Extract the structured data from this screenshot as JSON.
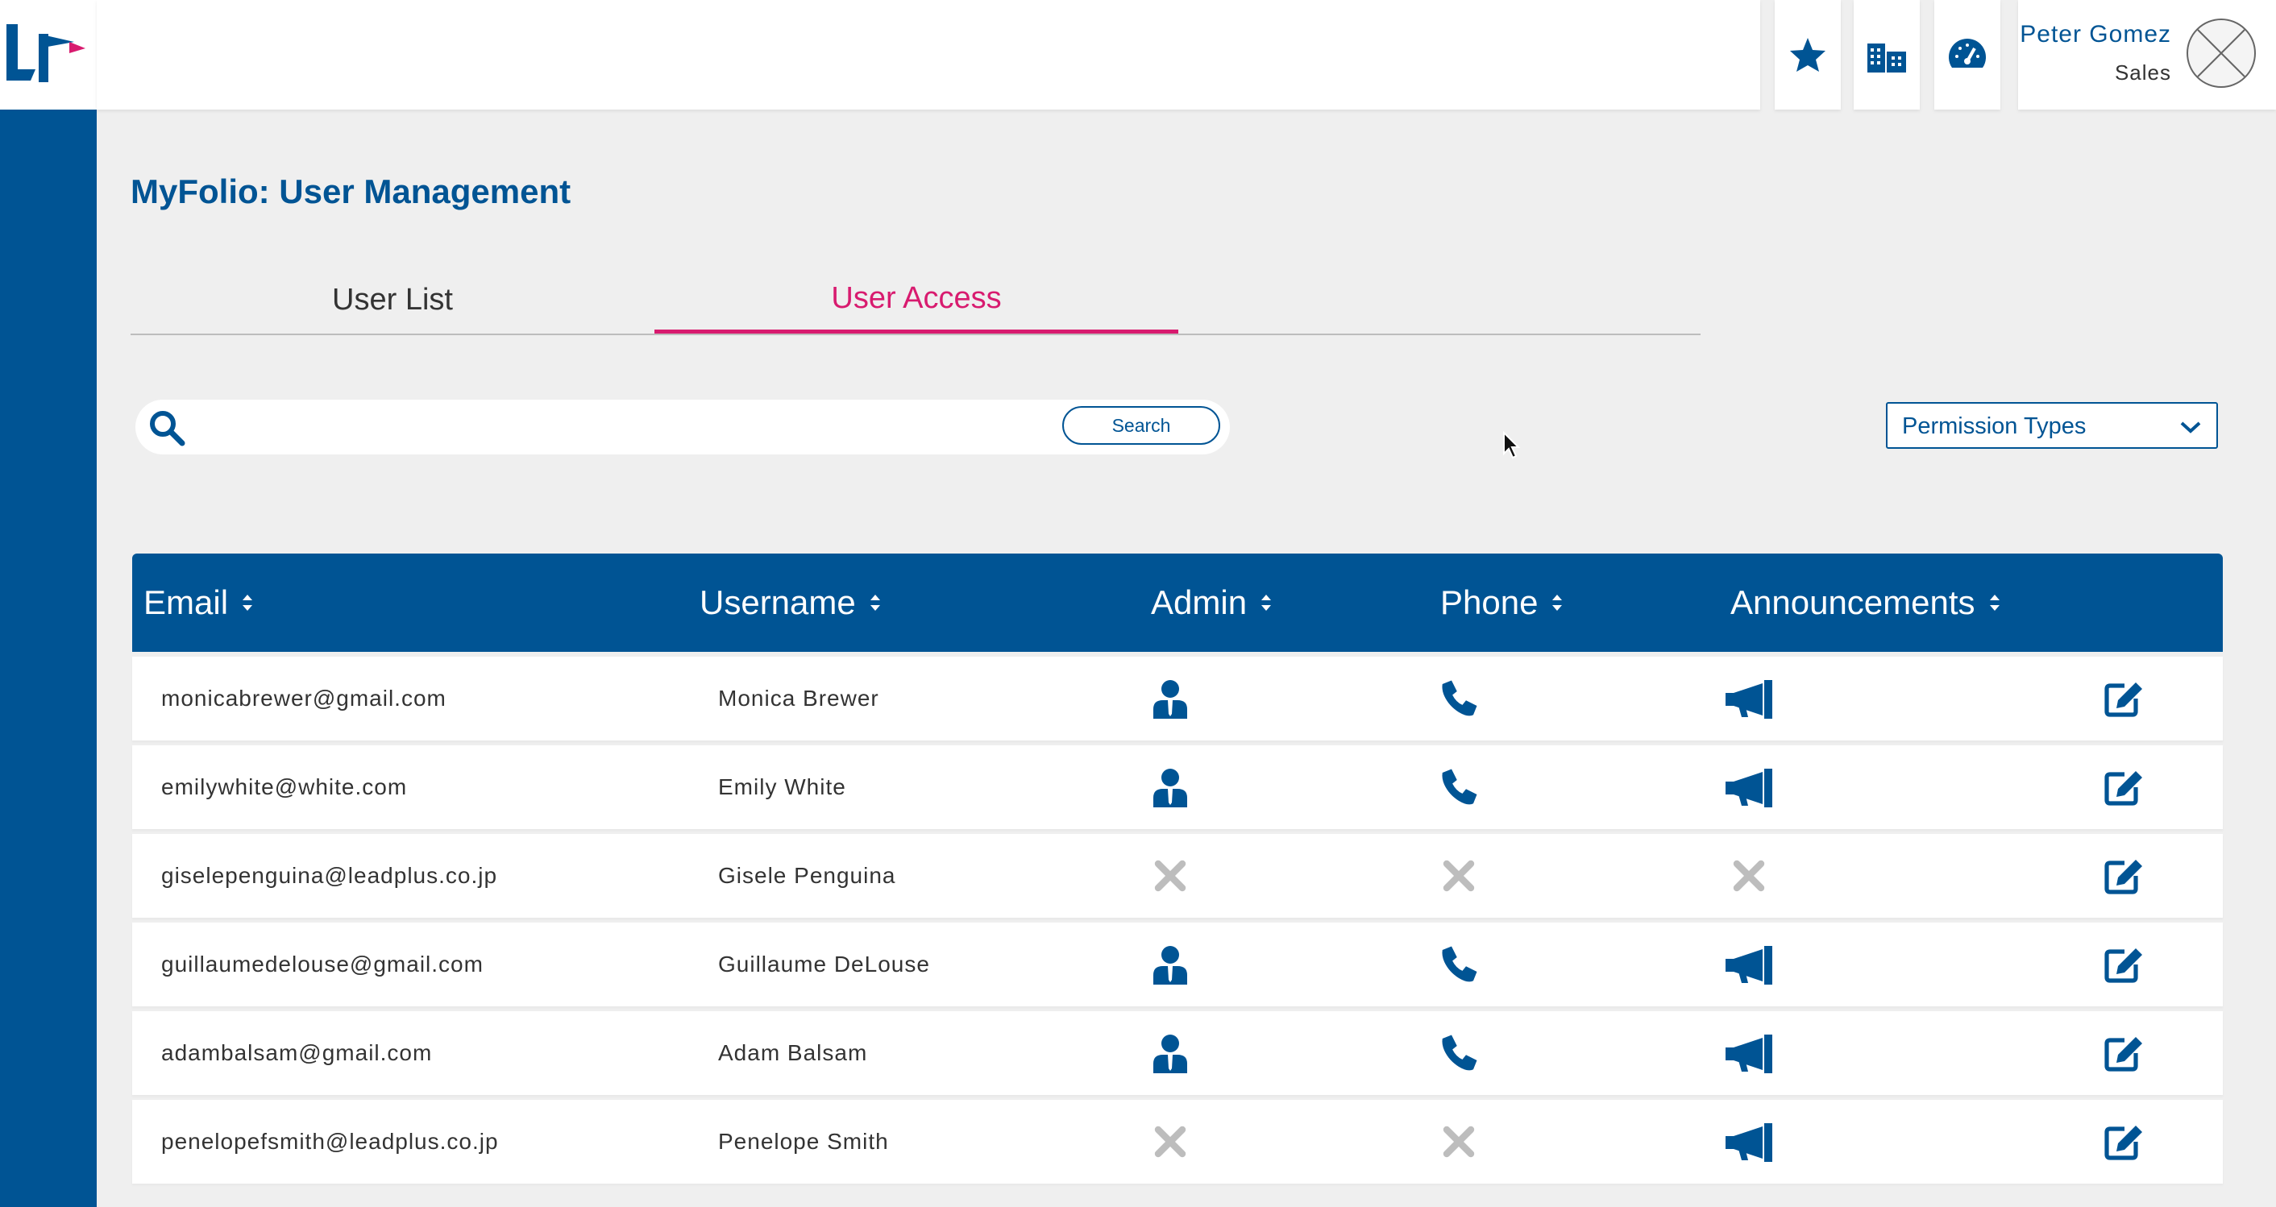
{
  "app": {
    "logo_text": "LF",
    "brand_color": "#005494",
    "accent_color": "#d81b6f"
  },
  "header": {
    "icons": [
      "star-icon",
      "buildings-icon",
      "speedometer-icon"
    ],
    "user": {
      "name": "Peter Gomez",
      "role": "Sales"
    }
  },
  "page": {
    "title": "MyFolio: User Management",
    "tabs": [
      {
        "label": "User List",
        "active": false
      },
      {
        "label": "User Access",
        "active": true
      }
    ]
  },
  "search": {
    "value": "",
    "button_label": "Search"
  },
  "filter": {
    "label": "Permission Types"
  },
  "table": {
    "columns": [
      "Email",
      "Username",
      "Admin",
      "Phone",
      "Announcements"
    ],
    "rows": [
      {
        "email": "monicabrewer@gmail.com",
        "username": "Monica Brewer",
        "admin": true,
        "phone": true,
        "announcements": true
      },
      {
        "email": "emilywhite@white.com",
        "username": "Emily White",
        "admin": true,
        "phone": true,
        "announcements": true
      },
      {
        "email": "giselepenguina@leadplus.co.jp",
        "username": "Gisele Penguina",
        "admin": false,
        "phone": false,
        "announcements": false
      },
      {
        "email": "guillaumedelouse@gmail.com",
        "username": "Guillaume DeLouse",
        "admin": true,
        "phone": true,
        "announcements": true
      },
      {
        "email": "adambalsam@gmail.com",
        "username": "Adam Balsam",
        "admin": true,
        "phone": true,
        "announcements": true
      },
      {
        "email": "penelopefsmith@leadplus.co.jp",
        "username": "Penelope Smith",
        "admin": false,
        "phone": false,
        "announcements": true
      }
    ]
  }
}
